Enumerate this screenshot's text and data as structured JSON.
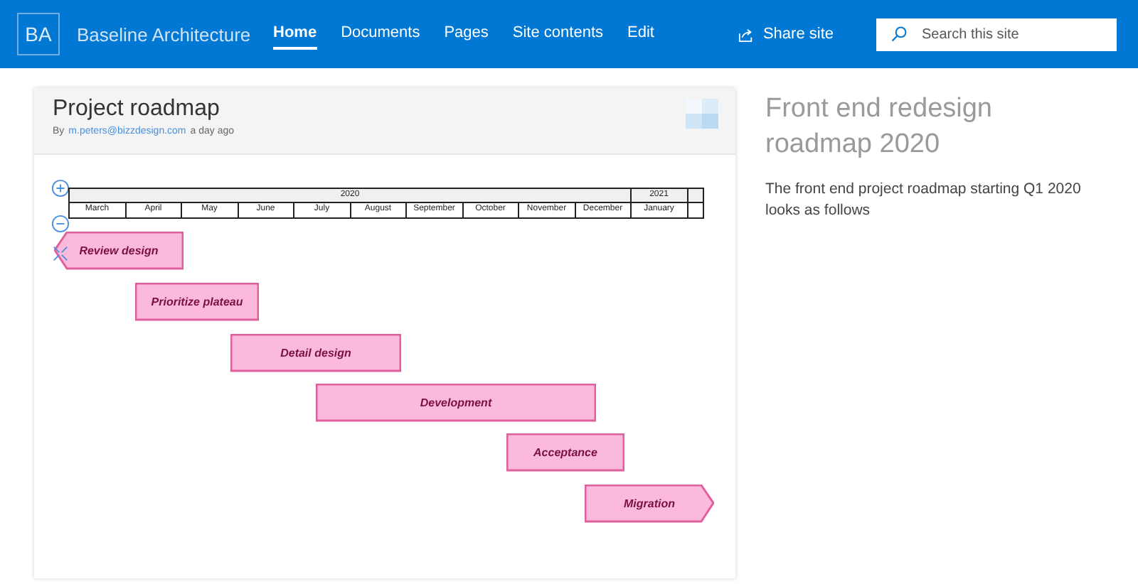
{
  "header": {
    "logo": "BA",
    "site_title": "Baseline Architecture",
    "nav": [
      {
        "label": "Home",
        "selected": true
      },
      {
        "label": "Documents",
        "selected": false
      },
      {
        "label": "Pages",
        "selected": false
      },
      {
        "label": "Site contents",
        "selected": false
      },
      {
        "label": "Edit",
        "selected": false
      }
    ],
    "share": "Share site",
    "search": {
      "placeholder": "Search this site"
    }
  },
  "card": {
    "title": "Project roadmap",
    "byline_prefix": "By",
    "author": "m.peters@bizzdesign.com",
    "time": "a day ago",
    "timeline": {
      "years": [
        "2020",
        "2021"
      ],
      "months": [
        "March",
        "April",
        "May",
        "June",
        "July",
        "August",
        "September",
        "October",
        "November",
        "December",
        "January"
      ],
      "tasks": [
        {
          "label": "Review design",
          "kind": "start"
        },
        {
          "label": "Prioritize plateau",
          "kind": "middle"
        },
        {
          "label": "Detail design",
          "kind": "middle"
        },
        {
          "label": "Development",
          "kind": "middle"
        },
        {
          "label": "Acceptance",
          "kind": "middle"
        },
        {
          "label": "Migration",
          "kind": "end"
        }
      ]
    }
  },
  "aside": {
    "heading": "Front end redesign roadmap 2020",
    "text": "The front end project roadmap starting Q1 2020 looks as follows"
  }
}
